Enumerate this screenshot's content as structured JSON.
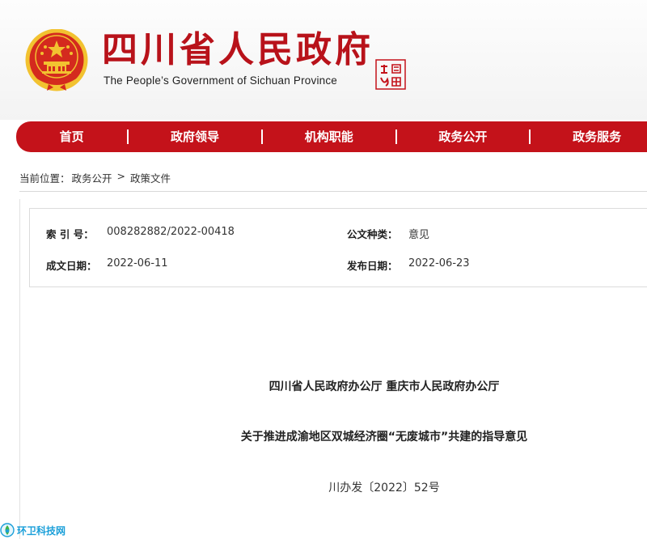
{
  "header": {
    "title": "四川省人民政府",
    "subtitle": "The People’s Government of Sichuan Province",
    "emblem_icon": "national-emblem-icon",
    "seal_icon": "seal-logo-icon"
  },
  "nav": {
    "items": [
      {
        "label": "首页"
      },
      {
        "label": "政府领导"
      },
      {
        "label": "机构职能"
      },
      {
        "label": "政务公开"
      },
      {
        "label": "政务服务"
      }
    ]
  },
  "breadcrumb": {
    "prefix": "当前位置：",
    "level1": "政务公开",
    "separator": ">",
    "level2": "政策文件"
  },
  "meta": {
    "index_label": "索 引 号：",
    "index_value": "008282882/2022-00418",
    "type_label": "公文种类：",
    "type_value": "意见",
    "created_label": "成文日期：",
    "created_value": "2022-06-11",
    "published_label": "发布日期：",
    "published_value": "2022-06-23"
  },
  "document": {
    "issuer": "四川省人民政府办公厅  重庆市人民政府办公厅",
    "title": "关于推进成渝地区双城经济圈“无废城市”共建的指导意见",
    "number": "川办发〔2022〕52号"
  },
  "watermark": {
    "text": "环卫科技网",
    "icon": "watermark-logo-icon"
  },
  "colors": {
    "brand_red": "#c4121a",
    "title_red": "#b8121a",
    "emblem_gold": "#f2c230",
    "watermark_blue": "#1a9fd9"
  }
}
